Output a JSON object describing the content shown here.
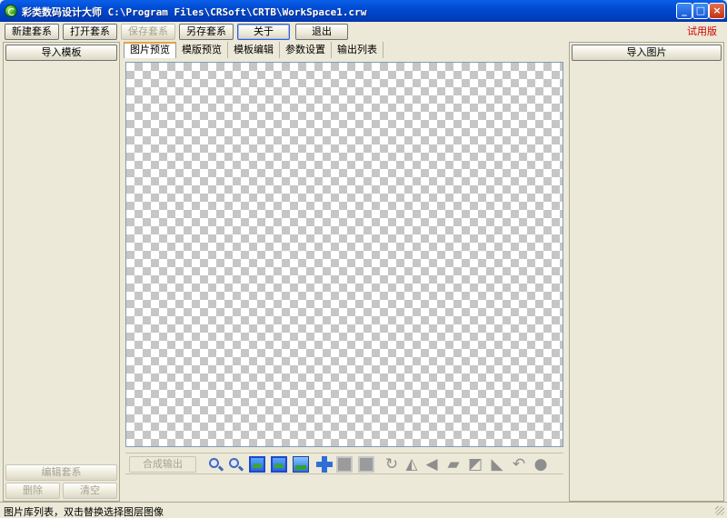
{
  "window": {
    "title": "彩类数码设计大师 C:\\Program Files\\CRSoft\\CRTB\\WorkSpace1.crw",
    "min_glyph": "_",
    "max_glyph": "□",
    "close_glyph": "×"
  },
  "toolbar": {
    "new_set": "新建套系",
    "open_set": "打开套系",
    "save_set": "保存套系",
    "save_as": "另存套系",
    "about": "关于",
    "exit": "退出",
    "trial_badge": "试用版"
  },
  "left_panel": {
    "import_template": "导入模板",
    "edit_set": "编辑套系",
    "delete": "删除",
    "clear": "清空"
  },
  "right_panel": {
    "import_image": "导入图片"
  },
  "tabs": [
    "图片预览",
    "模版预览",
    "模板编辑",
    "参数设置",
    "输出列表"
  ],
  "preview_tools": {
    "compose_output": "合成输出"
  },
  "status": {
    "text": "图片库列表，双击替换选择图层图像"
  },
  "colors": {
    "title_bar": "#0048d0",
    "trial_text": "#d10000",
    "checker_dark": "#c6c6c6"
  }
}
